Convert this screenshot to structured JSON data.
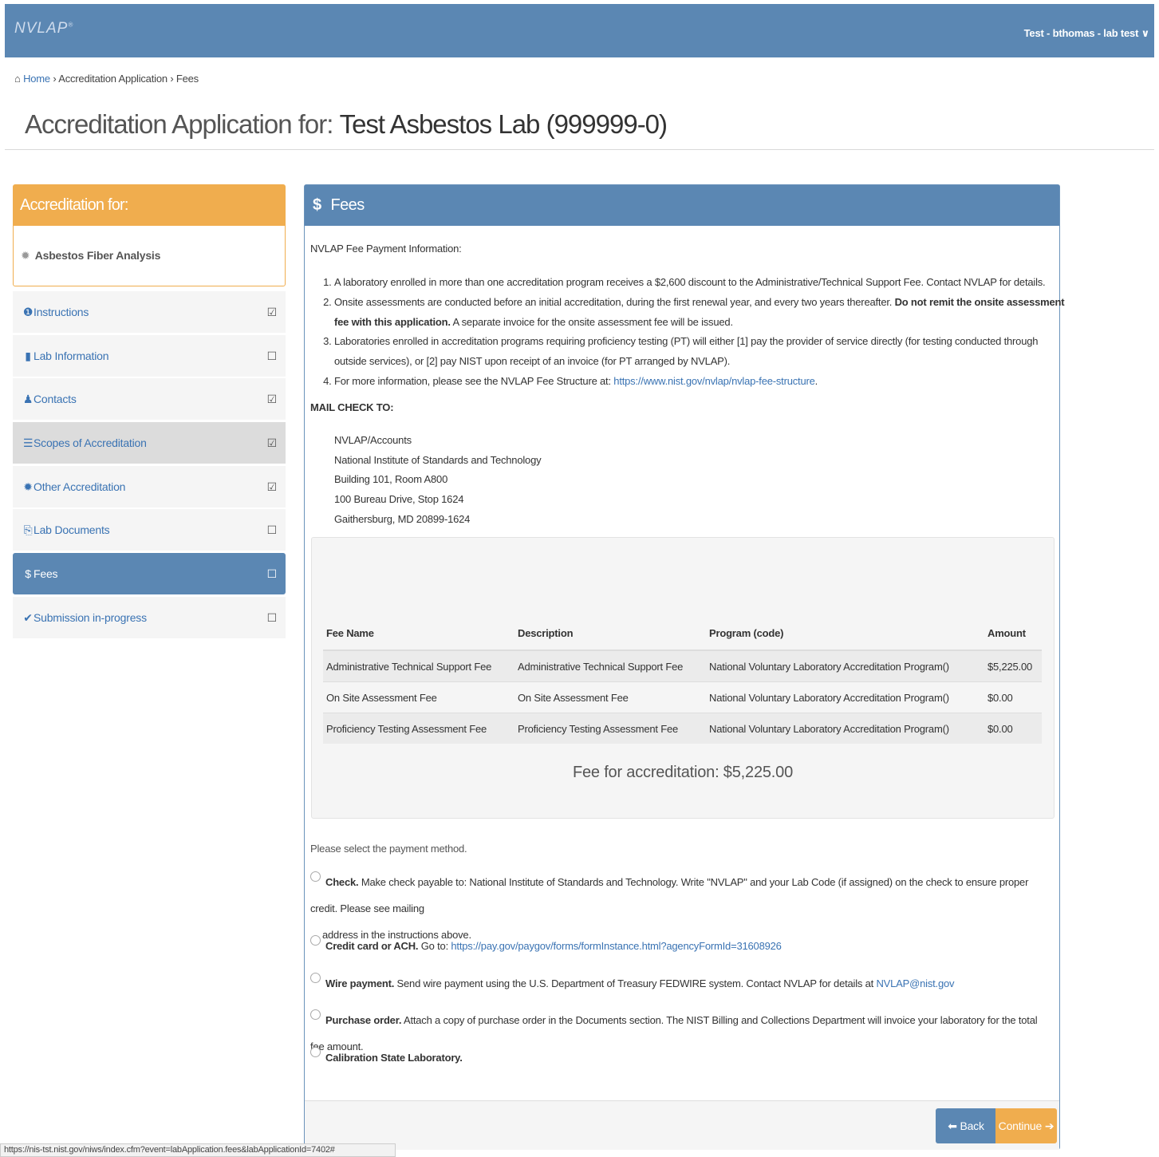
{
  "app": {
    "logo_text": "NVLAP",
    "user_menu": "Test - bthomas - lab test",
    "user_menu_chevron": "∨"
  },
  "breadcrumb": {
    "home_icon": "⌂",
    "home": "Home",
    "sep": "›",
    "item1": "Accreditation Application",
    "item2": "Fees"
  },
  "page_title": {
    "prefix": "Accreditation Application for: ",
    "lab": "Test Asbestos Lab (999999-0)"
  },
  "accreditation_box": {
    "header": "Accreditation for:",
    "item": "Asbestos Fiber Analysis"
  },
  "nav": {
    "items": [
      {
        "label": "Instructions",
        "icon": "info-icon",
        "glyph": "❶",
        "status": "☑"
      },
      {
        "label": "Lab Information",
        "icon": "building-icon",
        "glyph": "▮",
        "status": "☐"
      },
      {
        "label": "Contacts",
        "icon": "user-icon",
        "glyph": "♟",
        "status": "☑"
      },
      {
        "label": "Scopes of Accreditation",
        "icon": "list-icon",
        "glyph": "☰",
        "status": "☑"
      },
      {
        "label": "Other Accreditation",
        "icon": "certificate-icon",
        "glyph": "✹",
        "status": "☑"
      },
      {
        "label": "Lab Documents",
        "icon": "documents-icon",
        "glyph": "⎘",
        "status": "☐"
      },
      {
        "label": "Fees",
        "icon": "dollar-icon",
        "glyph": "$",
        "status": "☐"
      },
      {
        "label": "Submission in-progress",
        "icon": "checkmark-icon",
        "glyph": "✔",
        "status": "☐"
      }
    ]
  },
  "fees": {
    "header": "Fees",
    "header_icon": "$",
    "info_title": "NVLAP Fee Payment Information:",
    "info": {
      "p1": "A laboratory enrolled in more than one accreditation program receives a $2,600 discount to the Administrative/Technical Support Fee. Contact NVLAP for details.",
      "p2_text": "Onsite assessments are conducted before an initial accreditation, during the first renewal year, and every two years thereafter. ",
      "p2_bold": "Do not remit the onsite assessment fee with this application.",
      "p2_tail": " A separate invoice for the onsite assessment fee will be issued.",
      "p3": "Laboratories enrolled in accreditation programs requiring proficiency testing (PT) will either [1] pay the provider of service directly (for testing conducted through outside services), or [2] pay NIST upon receipt of an invoice (for PT arranged by NVLAP).",
      "p4_text": "For more information, please see the NVLAP Fee Structure at: ",
      "p4_link": "https://www.nist.gov/nvlap/nvlap-fee-structure",
      "p4_end": "."
    },
    "mail_title": "MAIL CHECK TO:",
    "address": {
      "line1": "NVLAP/Accounts",
      "line2": "National Institute of Standards and Technology",
      "line3": "Building 101, Room A800",
      "line4": "100 Bureau Drive, Stop 1624",
      "line5": "Gaithersburg, MD 20899-1624"
    },
    "table": {
      "headers": {
        "name": "Fee Name",
        "desc": "Description",
        "program": "Program (code)",
        "amount": "Amount"
      },
      "rows": [
        {
          "name": "Administrative Technical Support Fee",
          "desc": "Administrative Technical Support Fee",
          "program": "National Voluntary Laboratory Accreditation Program()",
          "amount": "$5,225.00"
        },
        {
          "name": "On Site Assessment Fee",
          "desc": "On Site Assessment Fee",
          "program": "National Voluntary Laboratory Accreditation Program()",
          "amount": "$0.00"
        },
        {
          "name": "Proficiency Testing Assessment Fee",
          "desc": "Proficiency Testing Assessment Fee",
          "program": "National Voluntary Laboratory Accreditation Program()",
          "amount": "$0.00"
        }
      ]
    },
    "total": "Fee for accreditation: $5,225.00",
    "payment_prompt": "Please select the payment method.",
    "payment": {
      "check_label": "Check.",
      "check_text": " Make check payable to: National Institute of Standards and Technology. Write \"NVLAP\" and your Lab Code (if assigned) on the check to ensure proper credit. Please see mailing",
      "check_text2": "address in the instructions above.",
      "cc_label": "Credit card or ACH.",
      "cc_text": " Go to: ",
      "cc_link": "https://pay.gov/paygov/forms/formInstance.html?agencyFormId=31608926",
      "wire_label": "Wire payment.",
      "wire_text": " Send wire payment using the U.S. Department of Treasury FEDWIRE system. Contact NVLAP for details at ",
      "wire_link": "NVLAP@nist.gov",
      "po_label": "Purchase order.",
      "po_text": " Attach a copy of purchase order in the Documents section. The NIST Billing and Collections Department will invoice your laboratory for the total fee amount.",
      "csl_label": "Calibration State Laboratory."
    },
    "back": "Back",
    "continue": "Continue"
  },
  "status_url": "https://nis-tst.nist.gov/niws/index.cfm?event=labApplication.fees&labApplicationId=7402#"
}
